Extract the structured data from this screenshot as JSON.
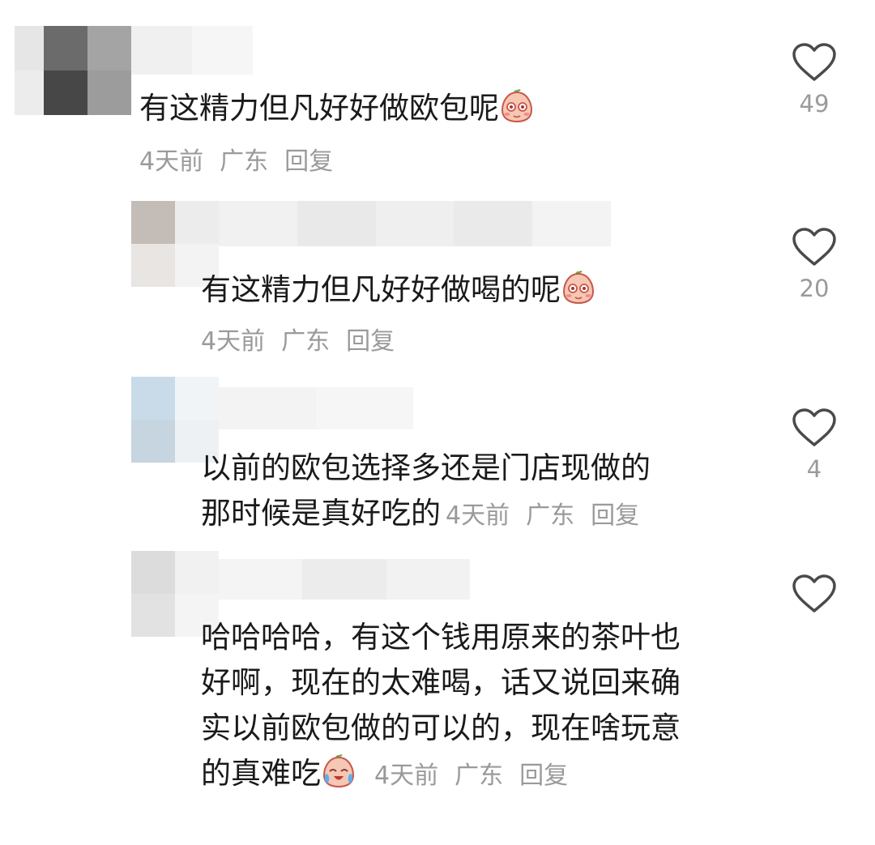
{
  "comments": [
    {
      "text": "有这精力但凡好好做欧包呢",
      "time": "4天前",
      "location": "广东",
      "reply": "回复",
      "likes": "49",
      "emoji": "smile-blush-emoji"
    },
    {
      "text": "有这精力但凡好好做喝的呢",
      "time": "4天前",
      "location": "广东",
      "reply": "回复",
      "likes": "20",
      "emoji": "smile-blush-emoji"
    },
    {
      "lines": [
        "以前的欧包选择多还是门店现做的",
        "那时候是真好吃的"
      ],
      "time": "4天前",
      "location": "广东",
      "reply": "回复",
      "likes": "4"
    },
    {
      "lines": [
        "哈哈哈哈，有这个钱用原来的茶叶也",
        "好啊，现在的太难喝，话又说回来确",
        "实以前欧包做的可以的，现在啥玩意",
        "的真难吃"
      ],
      "time": "4天前",
      "location": "广东",
      "reply": "回复",
      "likes": "",
      "emoji": "crying-laugh-emoji"
    }
  ],
  "colors": {
    "text": "#1a1a1a",
    "meta": "#9a9a9a",
    "heart_stroke": "#4a4a4a"
  }
}
